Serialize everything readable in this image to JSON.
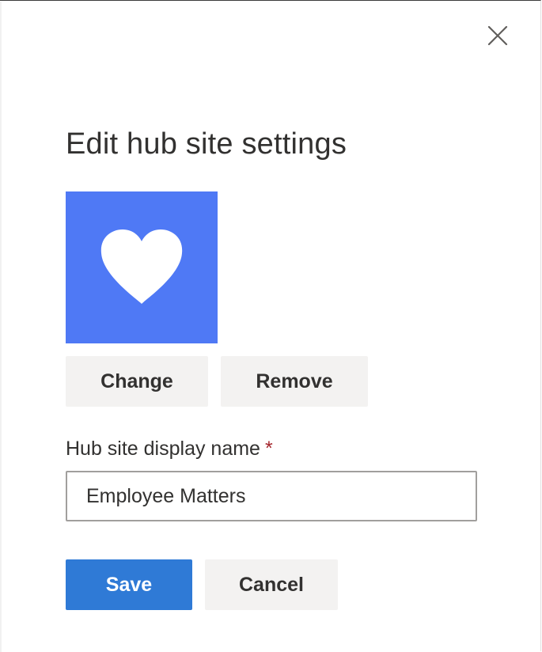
{
  "dialog": {
    "title": "Edit hub site settings",
    "close_icon": "close-icon"
  },
  "logo": {
    "icon": "heart-icon",
    "background_color": "#4f79f5"
  },
  "logo_actions": {
    "change_label": "Change",
    "remove_label": "Remove"
  },
  "display_name": {
    "label": "Hub site display name",
    "required_marker": "*",
    "value": "Employee Matters"
  },
  "footer": {
    "save_label": "Save",
    "cancel_label": "Cancel",
    "primary_color": "#2f7ad6"
  }
}
